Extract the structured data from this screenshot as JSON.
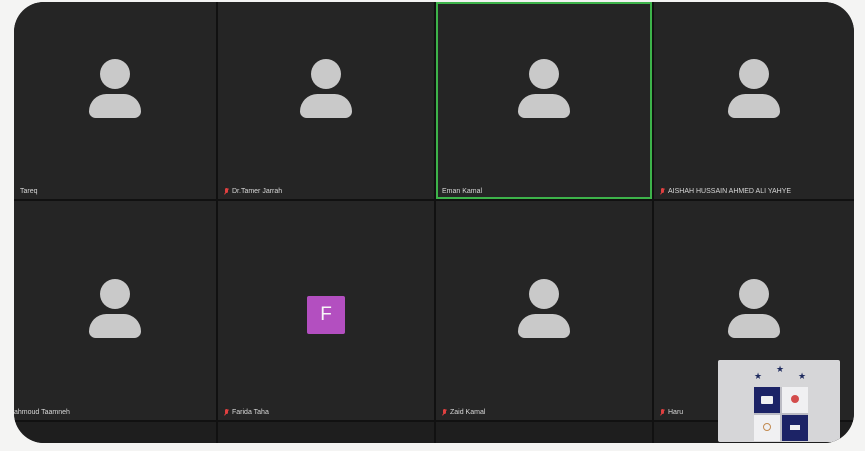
{
  "participants": [
    {
      "name": "Tareq",
      "muted": false,
      "type": "avatar"
    },
    {
      "name": "Dr.Tamer Jarrah",
      "muted": true,
      "type": "avatar"
    },
    {
      "name": "Eman Kamal",
      "muted": false,
      "type": "avatar",
      "speaking": true
    },
    {
      "name": "AISHAH HUSSAIN AHMED ALI YAHYE",
      "muted": true,
      "type": "avatar"
    },
    {
      "name": "ahmoud Taamneh",
      "muted": false,
      "type": "avatar"
    },
    {
      "name": "Farida Taha",
      "muted": true,
      "type": "initial",
      "initial": "F"
    },
    {
      "name": "Zaid Kamal",
      "muted": true,
      "type": "avatar"
    },
    {
      "name": "Haru",
      "muted": true,
      "type": "avatar"
    }
  ],
  "colors": {
    "tile_bg": "#252525",
    "speaking_border": "#3db34a",
    "initial_bg": "#b34fc0",
    "muted_icon": "#e04040"
  },
  "icons": {
    "avatar": "person-silhouette-icon",
    "muted": "mic-off-icon",
    "logo": "university-crest-icon"
  }
}
